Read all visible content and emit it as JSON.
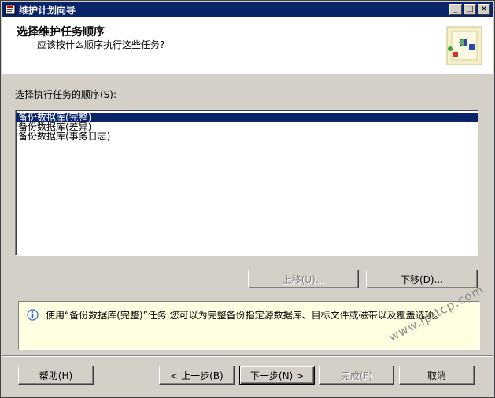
{
  "window": {
    "title": "维护计划向导",
    "controls": {
      "minimize": "_",
      "maximize": "□",
      "close": "×"
    }
  },
  "header": {
    "title": "选择维护任务顺序",
    "subtitle": "应该按什么顺序执行这些任务?"
  },
  "task_list": {
    "label": "选择执行任务的顺序(S):",
    "items": [
      "备份数据库(完整)",
      "备份数据库(差异)",
      "备份数据库(事务日志)"
    ],
    "selected_index": 0
  },
  "order_buttons": {
    "move_up": "上移(U)...",
    "move_down": "下移(D)..."
  },
  "info": {
    "text": "使用“备份数据库(完整)”任务,您可以为完整备份指定源数据库、目标文件或磁带以及覆盖选项。"
  },
  "footer": {
    "help": "帮助(H)",
    "back": "< 上一步(B)",
    "next": "下一步(N) >",
    "finish": "完成(F)",
    "cancel": "取消"
  },
  "watermark": "www.ip-tcp.com",
  "colors": {
    "titlebar": "#0a246a",
    "dialog_bg": "#d4d0c8",
    "info_bg": "#ffffe1",
    "selection": "#0a246a"
  }
}
